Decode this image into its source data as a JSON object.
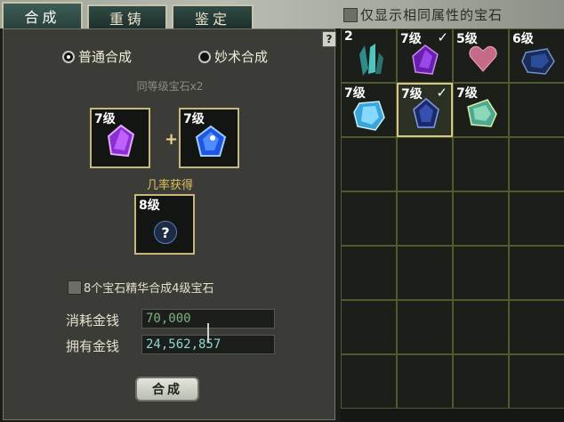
{
  "tabs": [
    {
      "label": "合成",
      "active": true
    },
    {
      "label": "重铸",
      "active": false
    },
    {
      "label": "鉴定",
      "active": false
    }
  ],
  "filter": {
    "label": "仅显示相同属性的宝石",
    "checked": false
  },
  "help_label": "?",
  "modes": [
    {
      "label": "普通合成",
      "selected": true
    },
    {
      "label": "妙术合成",
      "selected": false
    }
  ],
  "same_level_label": "同等级宝石x2",
  "input_slots": [
    {
      "level": "7级",
      "gem": "purple-gem-icon"
    },
    {
      "level": "7级",
      "gem": "blue-gem-icon"
    }
  ],
  "plus": "+",
  "probability_label": "几率获得",
  "result_slot": {
    "level": "8级",
    "mark": "?"
  },
  "essence": {
    "label": "8个宝石精华合成4级宝石",
    "checked": false
  },
  "cost": {
    "label": "消耗金钱",
    "value": "70,000"
  },
  "owned": {
    "label": "拥有金钱",
    "value": "24,562,857"
  },
  "synth_button": "合成",
  "inventory": [
    {
      "level": "2",
      "gem": "teal-crystal-icon",
      "checked": false,
      "selected": false
    },
    {
      "level": "7级",
      "gem": "purple-gem-icon",
      "checked": true,
      "selected": false
    },
    {
      "level": "5级",
      "gem": "pink-heart-gem-icon",
      "checked": false,
      "selected": false
    },
    {
      "level": "6级",
      "gem": "dark-blue-gem-icon",
      "checked": false,
      "selected": false
    },
    {
      "level": "7级",
      "gem": "ice-blue-gem-icon",
      "checked": false,
      "selected": false
    },
    {
      "level": "7级",
      "gem": "navy-gem-icon",
      "checked": true,
      "selected": true
    },
    {
      "level": "7级",
      "gem": "green-gem-icon",
      "checked": false,
      "selected": false
    }
  ],
  "colors": {
    "accent_gold": "#c8b77a",
    "cost_text": "#7fb07f",
    "owned_text": "#8fd7d3"
  }
}
